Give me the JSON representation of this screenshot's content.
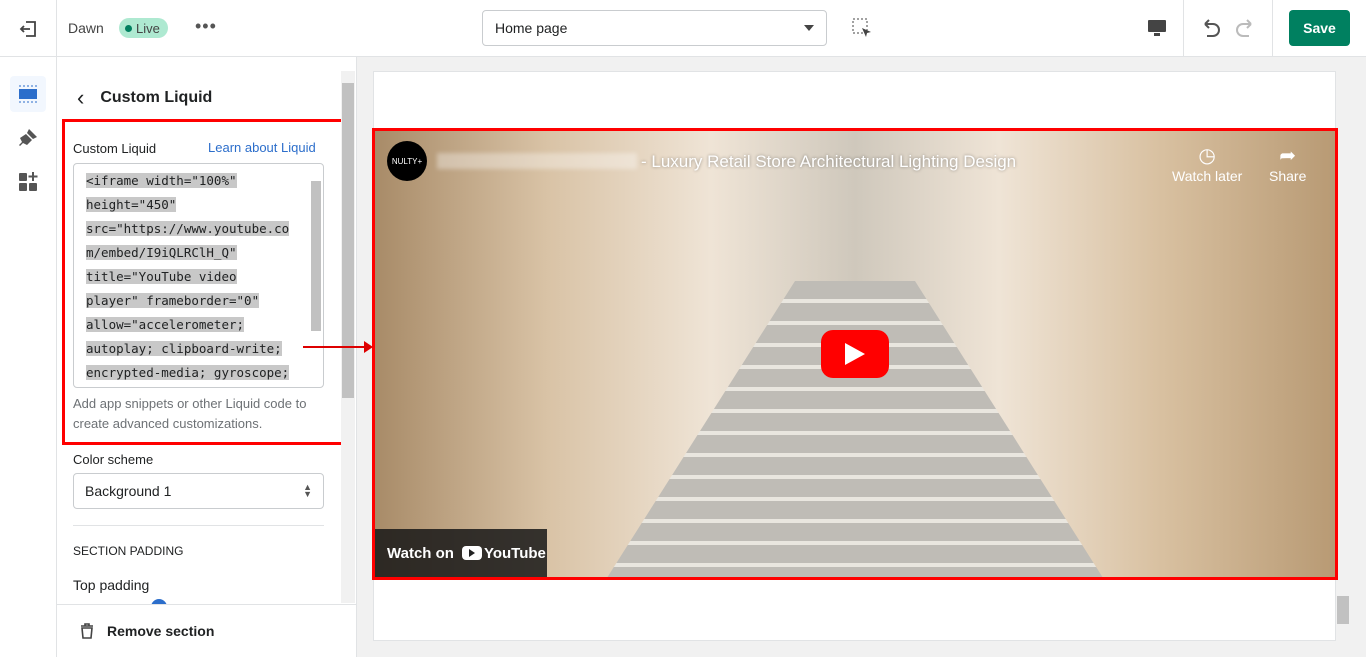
{
  "topbar": {
    "theme_name": "Dawn",
    "status_badge": "Live",
    "more_label": "•••",
    "page_select": "Home page",
    "save_label": "Save"
  },
  "panel": {
    "back_label": "‹",
    "title": "Custom Liquid",
    "custom_liquid": {
      "label": "Custom Liquid",
      "learn_link": "Learn about Liquid",
      "code_lines": [
        "<iframe width=\"100%\"",
        "height=\"450\"",
        "src=\"https://www.youtube.co",
        "m/embed/I9iQLRClH_Q\"",
        "title=\"YouTube video",
        "player\" frameborder=\"0\"",
        "allow=\"accelerometer;",
        "autoplay; clipboard-write;",
        "encrypted-media; gyroscope;"
      ],
      "help": "Add app snippets or other Liquid code to create advanced customizations."
    },
    "color_scheme": {
      "label": "Color scheme",
      "value": "Background 1"
    },
    "section_padding_heading": "SECTION PADDING",
    "top_padding_label": "Top padding",
    "remove_section": "Remove section"
  },
  "video": {
    "channel_logo": "NULTY+",
    "title": "- Luxury Retail Store Architectural Lighting Design",
    "watch_later": "Watch later",
    "share": "Share",
    "watch_on": "Watch on",
    "youtube": "YouTube"
  },
  "colors": {
    "accent": "#008060",
    "highlight": "#ff0000",
    "link": "#2c6ecb"
  }
}
